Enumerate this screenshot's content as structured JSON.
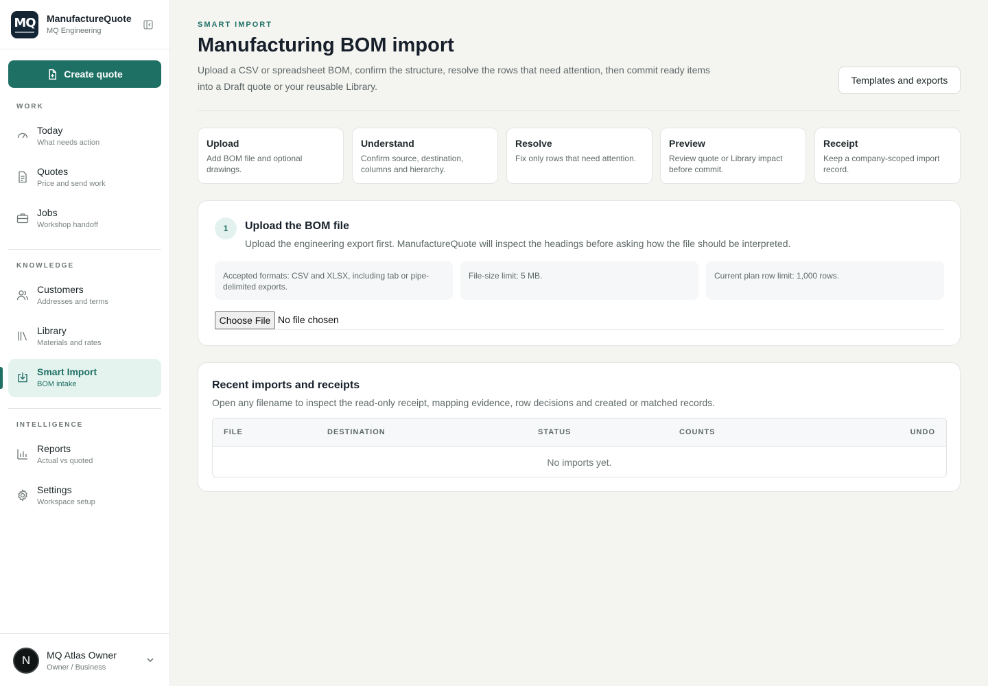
{
  "brand": {
    "logo_text": "MQ",
    "name": "ManufactureQuote",
    "workspace": "MQ Engineering"
  },
  "actions": {
    "create_quote": "Create quote"
  },
  "nav": {
    "sections": {
      "work": "WORK",
      "knowledge": "KNOWLEDGE",
      "intelligence": "INTELLIGENCE"
    },
    "items": [
      {
        "title": "Today",
        "sub": "What needs action",
        "icon": "gauge-icon"
      },
      {
        "title": "Quotes",
        "sub": "Price and send work",
        "icon": "document-icon"
      },
      {
        "title": "Jobs",
        "sub": "Workshop handoff",
        "icon": "briefcase-icon"
      },
      {
        "title": "Customers",
        "sub": "Addresses and terms",
        "icon": "users-icon"
      },
      {
        "title": "Library",
        "sub": "Materials and rates",
        "icon": "library-icon"
      },
      {
        "title": "Smart Import",
        "sub": "BOM intake",
        "icon": "import-icon",
        "active": true
      },
      {
        "title": "Reports",
        "sub": "Actual vs quoted",
        "icon": "bar-chart-icon"
      },
      {
        "title": "Settings",
        "sub": "Workspace setup",
        "icon": "gear-icon"
      }
    ]
  },
  "user": {
    "initial": "N",
    "name": "MQ Atlas Owner",
    "role": "Owner / Business"
  },
  "header": {
    "eyebrow": "SMART IMPORT",
    "title": "Manufacturing BOM import",
    "description": "Upload a CSV or spreadsheet BOM, confirm the structure, resolve the rows that need attention, then commit ready items into a Draft quote or your reusable Library.",
    "templates_button": "Templates and exports"
  },
  "steps": [
    {
      "title": "Upload",
      "text": "Add BOM file and optional drawings."
    },
    {
      "title": "Understand",
      "text": "Confirm source, destination, columns and hierarchy."
    },
    {
      "title": "Resolve",
      "text": "Fix only rows that need attention."
    },
    {
      "title": "Preview",
      "text": "Review quote or Library impact before commit."
    },
    {
      "title": "Receipt",
      "text": "Keep a company-scoped import record."
    }
  ],
  "upload": {
    "step_number": "1",
    "title": "Upload the BOM file",
    "description": "Upload the engineering export first. ManufactureQuote will inspect the headings before asking how the file should be interpreted.",
    "info": [
      "Accepted formats: CSV and XLSX, including tab or pipe-delimited exports.",
      "File-size limit: 5 MB.",
      "Current plan row limit: 1,000 rows."
    ],
    "choose_file": "Choose File",
    "no_file": "No file chosen"
  },
  "recent": {
    "title": "Recent imports and receipts",
    "description": "Open any filename to inspect the read-only receipt, mapping evidence, row decisions and created or matched records.",
    "columns": [
      "FILE",
      "DESTINATION",
      "STATUS",
      "COUNTS",
      "UNDO"
    ],
    "empty": "No imports yet."
  },
  "colors": {
    "accent": "#1e6f64",
    "accent_soft": "#e5f3ef",
    "logo_bg": "#132433",
    "page_bg": "#f4f4f1"
  }
}
